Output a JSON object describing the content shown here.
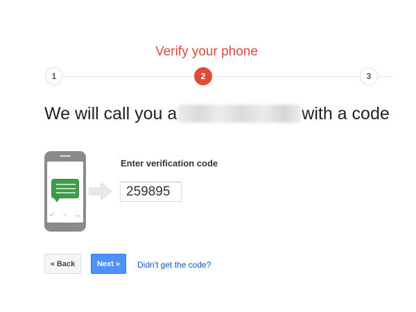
{
  "steps": {
    "title": "Verify your phone",
    "items": [
      {
        "number": "1",
        "state": "inactive"
      },
      {
        "number": "2",
        "state": "active"
      },
      {
        "number": "3",
        "state": "inactive"
      }
    ]
  },
  "headline": {
    "before": "We will call you a",
    "after": "with a code"
  },
  "verification": {
    "label": "Enter verification code",
    "value": "259895"
  },
  "actions": {
    "back_label": "« Back",
    "next_label": "Next »",
    "help_link": "Didn't get the code?"
  },
  "icons": {
    "phone": "phone-message-icon",
    "arrow": "arrow-right-icon"
  },
  "colors": {
    "accent_red": "#dd4b39",
    "primary_blue": "#4d90fe",
    "link_blue": "#1155cc",
    "message_green": "#3c9b4c"
  }
}
